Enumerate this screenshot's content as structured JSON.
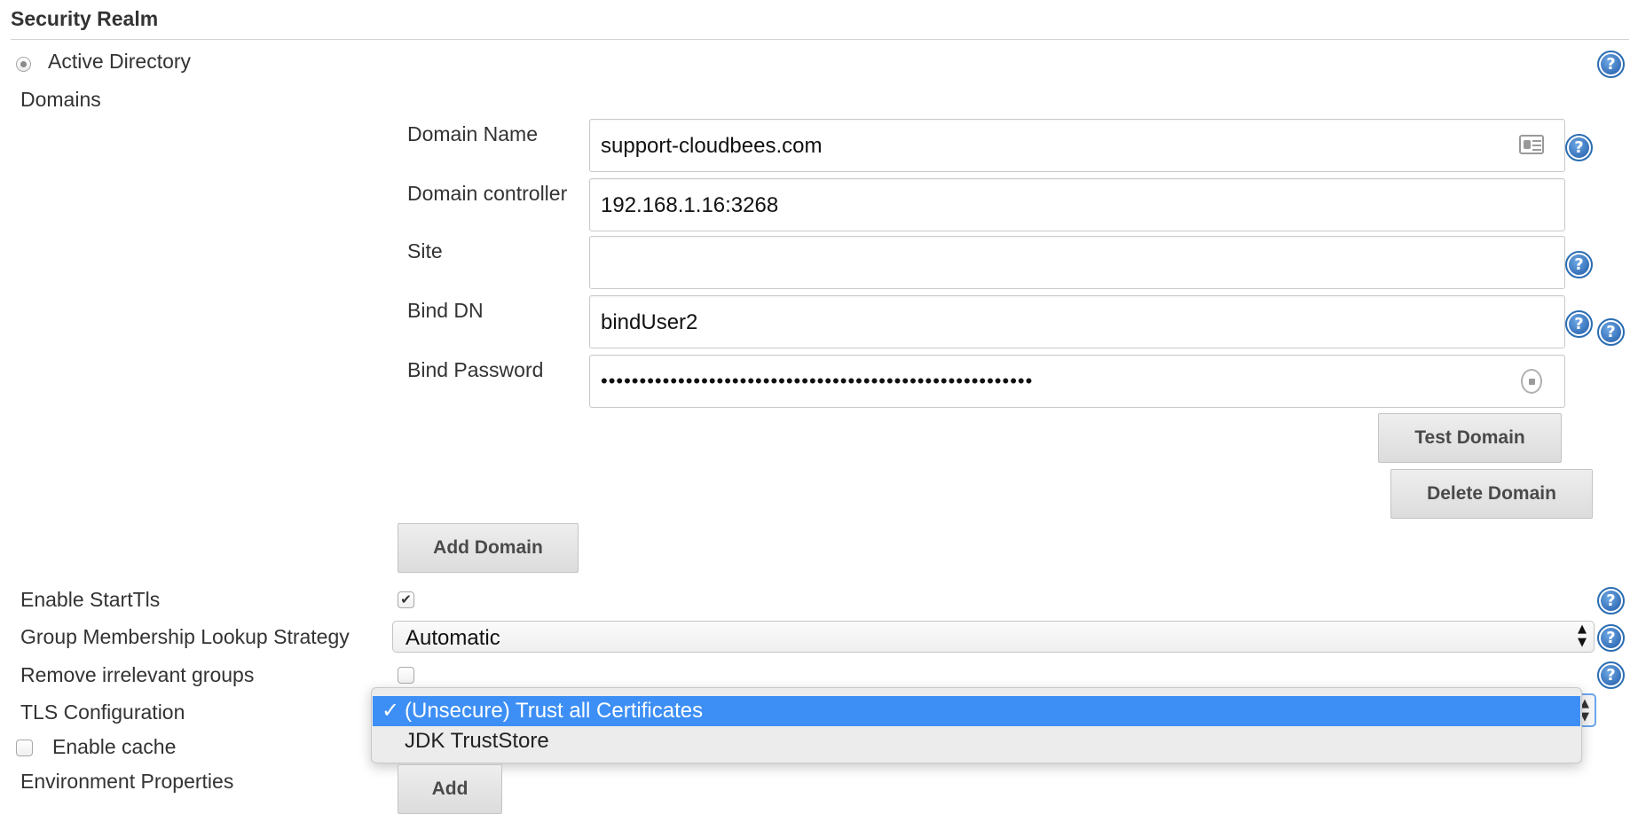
{
  "section": {
    "title": "Security Realm"
  },
  "realm": {
    "label": "Active Directory",
    "selected": true
  },
  "domains": {
    "label": "Domains",
    "fields": {
      "domain_name": {
        "label": "Domain Name",
        "value": "support-cloudbees.com"
      },
      "domain_controller": {
        "label": "Domain controller",
        "value": "192.168.1.16:3268"
      },
      "site": {
        "label": "Site",
        "value": ""
      },
      "bind_dn": {
        "label": "Bind DN",
        "value": "bindUser2"
      },
      "bind_password": {
        "label": "Bind Password",
        "value": "••••••••••••••••••••••••••••••••••••••••••••••••••••••••"
      }
    },
    "test_button": "Test Domain",
    "delete_button": "Delete Domain",
    "add_button": "Add Domain"
  },
  "options": {
    "enable_starttls": {
      "label": "Enable StartTls",
      "checked": true,
      "mark": "✔"
    },
    "group_lookup": {
      "label": "Group Membership Lookup Strategy",
      "value": "Automatic"
    },
    "remove_irrelevant": {
      "label": "Remove irrelevant groups",
      "checked": false
    },
    "tls_configuration": {
      "label": "TLS Configuration",
      "options": [
        "(Unsecure) Trust all Certificates",
        "JDK TrustStore"
      ],
      "selected_index": 0,
      "check_mark": "✓"
    },
    "enable_cache": {
      "label": "Enable cache",
      "checked": false
    },
    "environment_properties": {
      "label": "Environment Properties",
      "add_button": "Add"
    }
  },
  "icons": {
    "help": "help-icon",
    "help_glyph": "?",
    "select_arrows": "▲▼",
    "contact_card": "contact-card-icon",
    "password_lock": "password-lock-icon"
  },
  "colors": {
    "accent": "#3d8ff5",
    "help_blue": "#1f5aa8",
    "focus_ring": "#6aa6ee"
  }
}
